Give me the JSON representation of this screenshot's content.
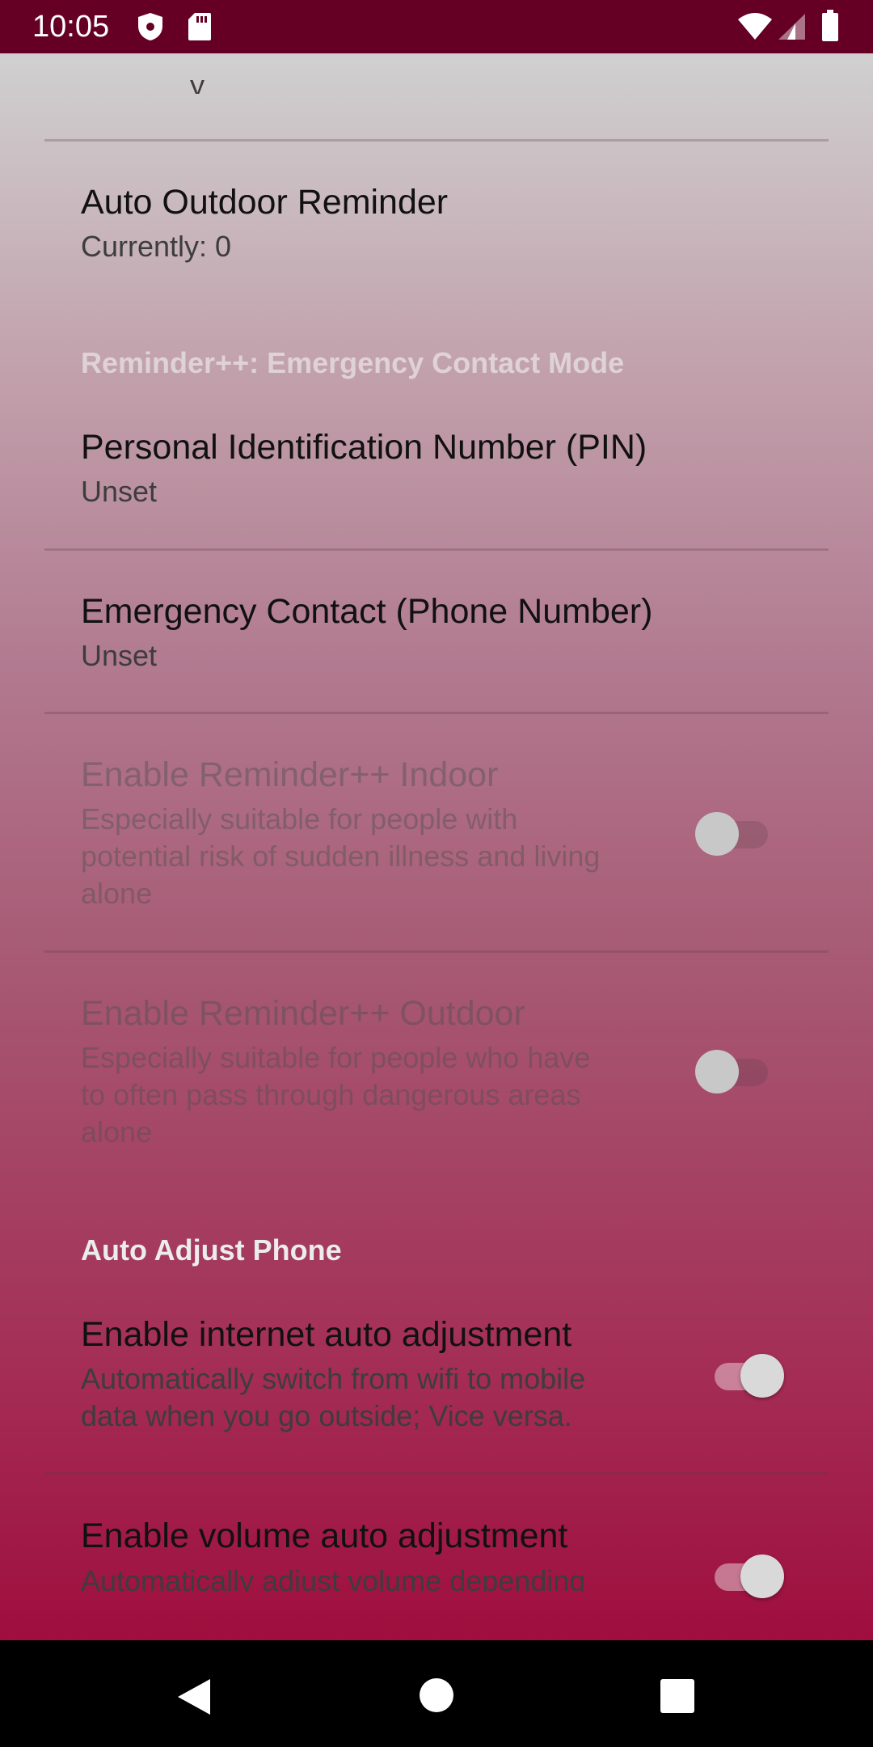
{
  "status_bar": {
    "time": "10:05",
    "icons_left": [
      "shield-icon",
      "sd-card-icon"
    ],
    "icons_right": [
      "wifi-icon",
      "cell-signal-icon",
      "battery-icon"
    ],
    "color": "#650024"
  },
  "prefs": {
    "cut_off_text": "y",
    "auto_outdoor_reminder": {
      "title": "Auto Outdoor Reminder",
      "summary": "Currently: 0"
    },
    "section_emergency": "Reminder++: Emergency Contact Mode",
    "pin": {
      "title": "Personal Identification Number (PIN)",
      "summary": "Unset"
    },
    "emergency_contact": {
      "title": "Emergency Contact (Phone Number)",
      "summary": "Unset"
    },
    "reminder_indoor": {
      "title": "Enable Reminder++ Indoor",
      "summary_lines": [
        "Especially suitable for people with",
        "potential risk of sudden illness and living",
        "alone"
      ],
      "enabled": false
    },
    "reminder_outdoor": {
      "title": "Enable Reminder++ Outdoor",
      "summary_lines": [
        "Especially suitable for people who have",
        "to often pass through dangerous areas",
        "alone"
      ],
      "enabled": false
    },
    "section_auto_adjust": "Auto Adjust Phone",
    "internet_auto": {
      "title": "Enable internet auto adjustment",
      "summary_lines": [
        "Automatically switch from wifi to mobile",
        "data when you go outside; Vice versa."
      ],
      "enabled": true
    },
    "volume_auto": {
      "title": "Enable volume auto adjustment",
      "summary_lines": [
        "Automatically adjust volume depending"
      ],
      "enabled": true
    }
  },
  "nav_bar": {
    "buttons": [
      "back-icon",
      "home-icon",
      "recents-icon"
    ]
  }
}
